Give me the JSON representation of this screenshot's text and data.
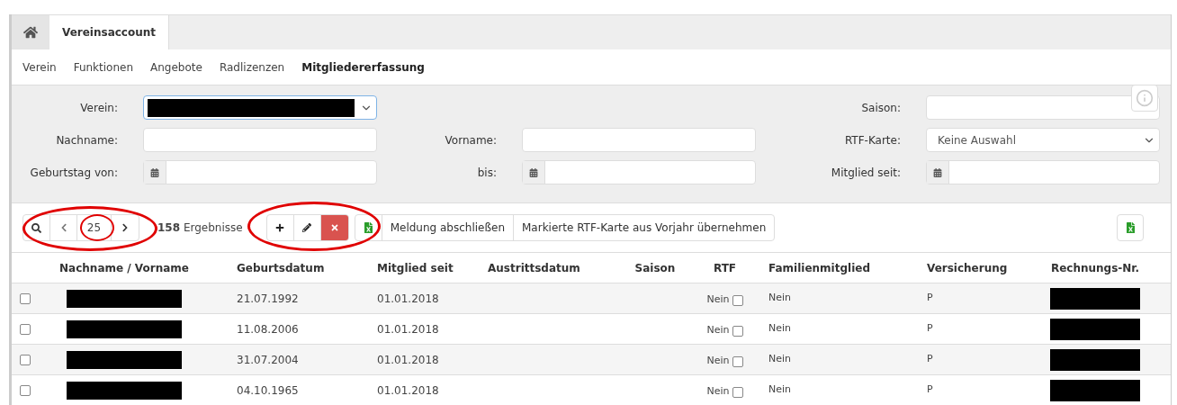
{
  "tabs": [
    {
      "kind": "home",
      "selected": false
    },
    {
      "kind": "text",
      "label": "Vereinsaccount",
      "selected": true
    }
  ],
  "subnav": [
    {
      "label": "Verein",
      "selected": false
    },
    {
      "label": "Funktionen",
      "selected": false
    },
    {
      "label": "Angebote",
      "selected": false
    },
    {
      "label": "Radlizenzen",
      "selected": false
    },
    {
      "label": "Mitgliedererfassung",
      "selected": true
    }
  ],
  "filters": [
    [
      {
        "label": "Verein:",
        "kind": "select",
        "redacted": true,
        "focused": true
      },
      {
        "label": "Saison:",
        "kind": "input"
      }
    ],
    [
      {
        "label": "Nachname:",
        "kind": "input"
      },
      {
        "label": "Vorname:",
        "kind": "input"
      },
      {
        "label": "RTF-Karte:",
        "kind": "select",
        "value": "Keine Auswahl"
      }
    ],
    [
      {
        "label": "Geburtstag von:",
        "kind": "date"
      },
      {
        "label": "bis:",
        "kind": "date"
      },
      {
        "label": "Mitglied seit:",
        "kind": "date"
      }
    ]
  ],
  "toolbar": {
    "page_size": "25",
    "result_count": "158",
    "result_label": "Ergebnisse",
    "actions": [
      "Meldung abschließen",
      "Markierte RTF-Karte aus Vorjahr übernehmen"
    ]
  },
  "table": {
    "columns": [
      "Nachname / Vorname",
      "Geburtsdatum",
      "Mitglied seit",
      "Austrittsdatum",
      "Saison",
      "RTF",
      "Familienmitglied",
      "Versicherung",
      "Rechnungs-Nr."
    ],
    "rows": [
      {
        "selected": false,
        "birth": "21.07.1992",
        "member_since": "01.01.2018",
        "rtf": "Nein",
        "rtf_checked": false,
        "family": "Nein",
        "insurance": "P"
      },
      {
        "selected": false,
        "birth": "11.08.2006",
        "member_since": "01.01.2018",
        "rtf": "Nein",
        "rtf_checked": false,
        "family": "Nein",
        "insurance": "P"
      },
      {
        "selected": false,
        "birth": "31.07.2004",
        "member_since": "01.01.2018",
        "rtf": "Nein",
        "rtf_checked": false,
        "family": "Nein",
        "insurance": "P"
      },
      {
        "selected": false,
        "birth": "04.10.1965",
        "member_since": "01.01.2018",
        "rtf": "Nein",
        "rtf_checked": false,
        "family": "Nein",
        "insurance": "P"
      }
    ]
  }
}
